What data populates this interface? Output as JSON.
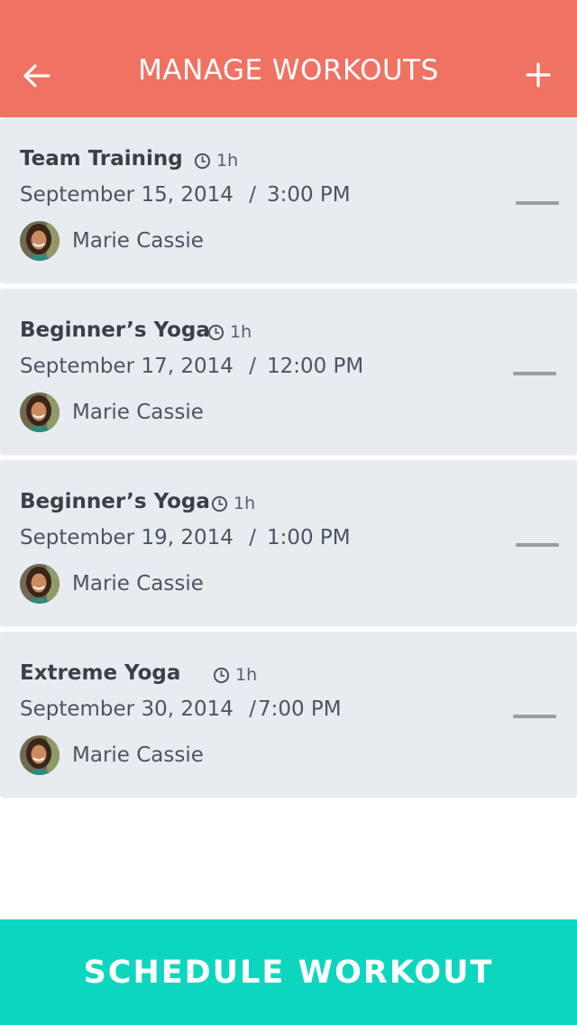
{
  "header": {
    "title": "MANAGE WORKOUTS",
    "back_icon": "arrow-left-icon",
    "add_icon": "plus-icon",
    "background": "#ef7262"
  },
  "workouts": [
    {
      "name": "Team Training",
      "duration": "1h",
      "date": "September 15, 2014",
      "separator": "/",
      "time": "3:00 PM",
      "trainer": "Marie Cassie"
    },
    {
      "name": "Beginner’s Yoga",
      "duration": "1h",
      "date": "September 17, 2014",
      "separator": "/",
      "time": "12:00 PM",
      "trainer": "Marie Cassie"
    },
    {
      "name": "Beginner’s Yoga",
      "duration": "1h",
      "date": "September 19, 2014",
      "separator": "/",
      "time": "1:00 PM",
      "trainer": "Marie Cassie"
    },
    {
      "name": "Extreme Yoga",
      "duration": "1h",
      "date": "September 30, 2014",
      "separator": "/",
      "time": "7:00 PM",
      "trainer": "Marie Cassie"
    }
  ],
  "cta": {
    "label": "SCHEDULE WORKOUT",
    "background": "#0dd6bf"
  }
}
